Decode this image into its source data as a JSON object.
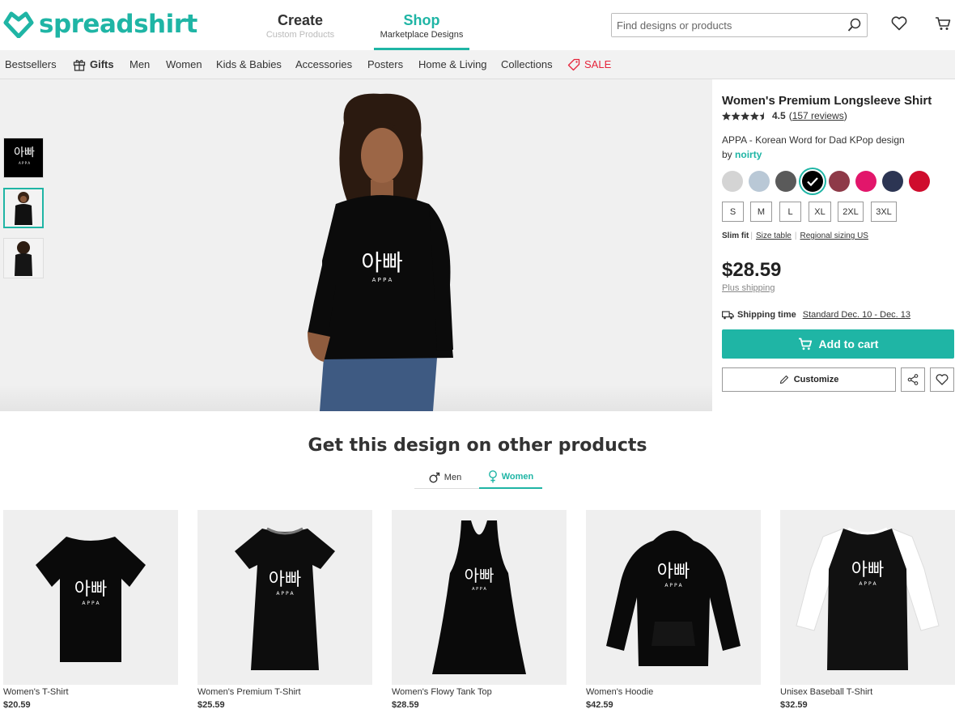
{
  "brand": {
    "name": "spreadshirt",
    "color": "#1fb5a5"
  },
  "header": {
    "tabs": [
      {
        "label": "Create",
        "sub": "Custom Products"
      },
      {
        "label": "Shop",
        "sub": "Marketplace Designs"
      }
    ],
    "search_placeholder": "Find designs or products"
  },
  "nav": {
    "items": [
      "Bestsellers",
      "Gifts",
      "Men",
      "Women",
      "Kids & Babies",
      "Accessories",
      "Posters",
      "Home & Living",
      "Collections",
      "SALE"
    ]
  },
  "product": {
    "title": "Women's Premium Longsleeve Shirt",
    "rating": "4.5",
    "reviews": "157 reviews",
    "design_name": "APPA - Korean Word for Dad KPop design",
    "by_label": "by",
    "designer": "noirty",
    "design_text_kr": "아빠",
    "design_text_en": "A P P A",
    "colors": [
      "#d4d4d4",
      "#b9c8d6",
      "#5a5a5a",
      "#000000",
      "#8e3a48",
      "#e2166b",
      "#2c3553",
      "#cf0d2d"
    ],
    "selected_color": "#000000",
    "sizes": [
      "S",
      "M",
      "L",
      "XL",
      "2XL",
      "3XL"
    ],
    "fit": "Slim fit",
    "size_table": "Size table",
    "regional": "Regional sizing US",
    "price": "$28.59",
    "plus_shipping": "Plus shipping",
    "shipping_label": "Shipping time",
    "shipping_value": "Standard Dec. 10 - Dec. 13",
    "add_to_cart": "Add to cart",
    "customize": "Customize"
  },
  "other": {
    "title": "Get this design on other products",
    "tabs": [
      "Men",
      "Women"
    ],
    "active_tab": "Women",
    "products": [
      {
        "name": "Women's T-Shirt",
        "price": "$20.59"
      },
      {
        "name": "Women's Premium T-Shirt",
        "price": "$25.59"
      },
      {
        "name": "Women's Flowy Tank Top",
        "price": "$28.59"
      },
      {
        "name": "Women's Hoodie",
        "price": "$42.59"
      },
      {
        "name": "Unisex Baseball T-Shirt",
        "price": "$32.59"
      }
    ]
  }
}
